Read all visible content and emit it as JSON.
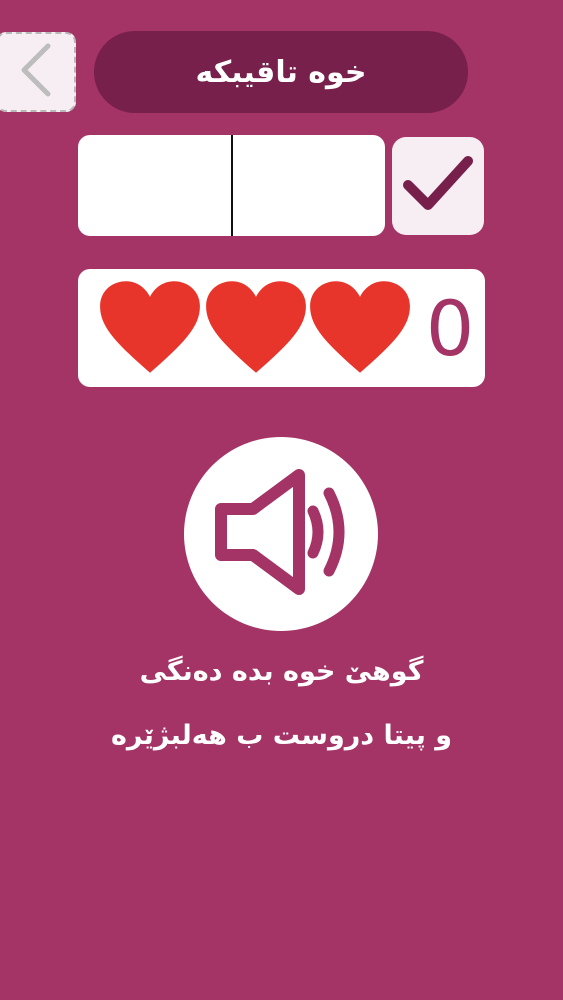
{
  "header": {
    "back_icon": "chevron-left-icon",
    "title": "خوە تاقیبکە"
  },
  "answer": {
    "slots": [
      "",
      ""
    ],
    "check_icon": "checkmark-icon"
  },
  "lives": {
    "hearts": 3,
    "heart_color": "#e8352c",
    "score": "0"
  },
  "sound": {
    "icon": "speaker-icon"
  },
  "instructions": {
    "line1": "گوهێ خوە بدە دەنگی",
    "line2": "و پیتا دروست ب هەلبژێرە"
  },
  "colors": {
    "background": "#a43366",
    "title_pill": "#76204b",
    "card": "#ffffff",
    "button": "#f6eef3"
  }
}
